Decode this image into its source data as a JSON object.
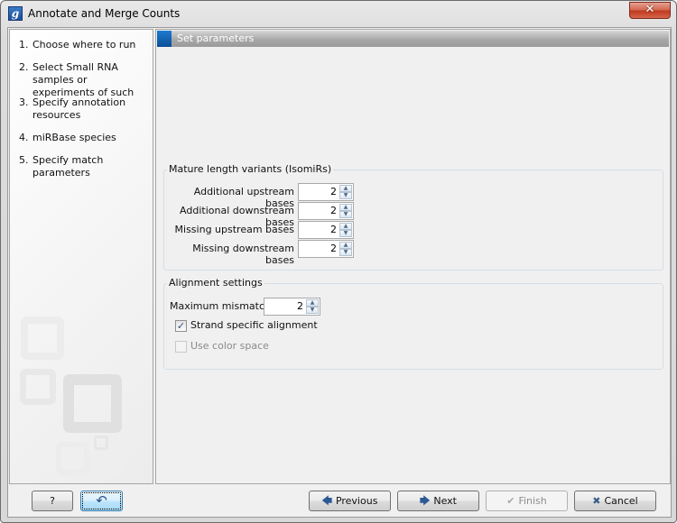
{
  "window": {
    "title": "Annotate and Merge Counts",
    "app_icon_glyph": "g",
    "close_glyph": "✕"
  },
  "sidebar": {
    "steps": [
      {
        "num": "1.",
        "label": "Choose where to run"
      },
      {
        "num": "2.",
        "label": "Select Small RNA samples or experiments of such"
      },
      {
        "num": "3.",
        "label": "Specify annotation resources"
      },
      {
        "num": "4.",
        "label": "miRBase species"
      },
      {
        "num": "5.",
        "label": "Specify match parameters"
      }
    ]
  },
  "main": {
    "section_title": "Set parameters",
    "isomirs": {
      "title": "Mature length variants (IsomiRs)",
      "fields": [
        {
          "label": "Additional upstream bases",
          "value": "2"
        },
        {
          "label": "Additional downstream bases",
          "value": "2"
        },
        {
          "label": "Missing upstream bases",
          "value": "2"
        },
        {
          "label": "Missing downstream bases",
          "value": "2"
        }
      ]
    },
    "alignment": {
      "title": "Alignment settings",
      "max_mismatches_label": "Maximum mismatches",
      "max_mismatches_value": "2",
      "strand_specific_label": "Strand specific alignment",
      "strand_specific_checked": true,
      "color_space_label": "Use color space",
      "color_space_checked": false,
      "color_space_enabled": false
    },
    "spin_up": "▲",
    "spin_down": "▼"
  },
  "footer": {
    "help_label": "?",
    "reset_glyph": "↶",
    "previous_label": "Previous",
    "next_label": "Next",
    "finish_label": "Finish",
    "cancel_label": "Cancel",
    "previous_icon": "🡄",
    "next_icon": "🡆",
    "finish_icon": "✔",
    "cancel_icon": "✖",
    "checkmark": "✓"
  }
}
